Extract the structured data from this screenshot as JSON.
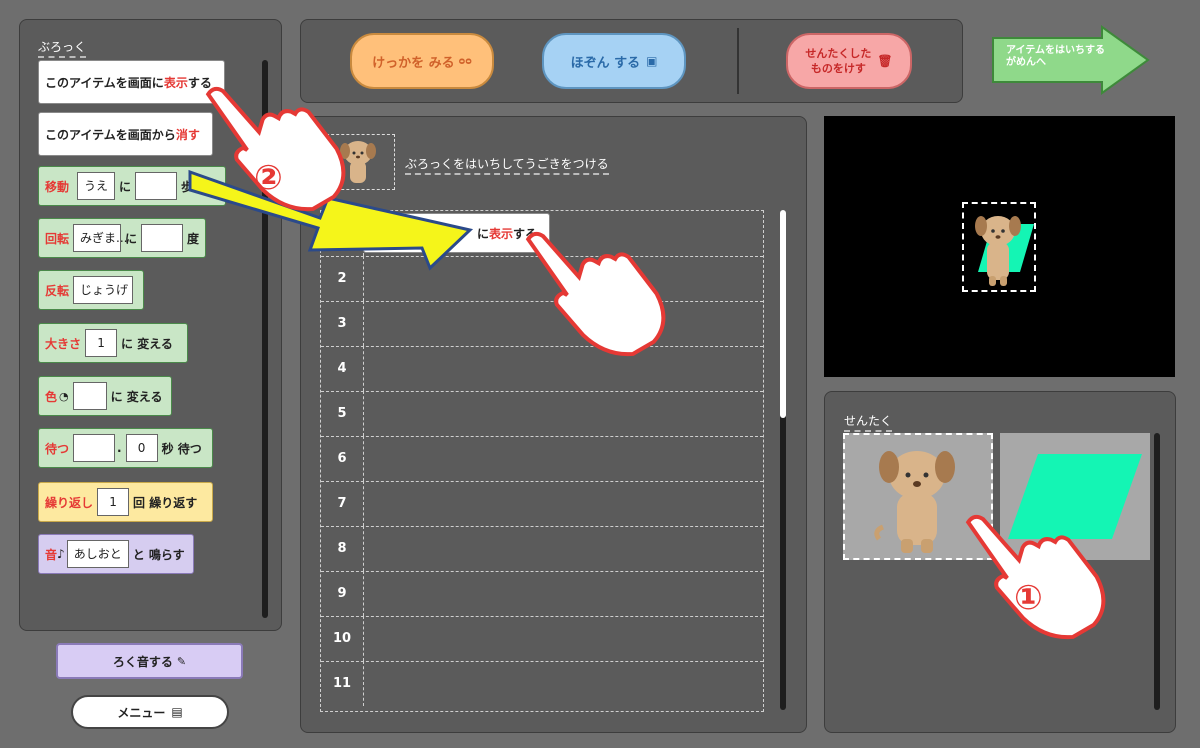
{
  "palette": {
    "title": "ぶろっく",
    "b1": {
      "pre": "このアイテムを画面に",
      "kw": "表示",
      "post": "する"
    },
    "b2": {
      "pre": "このアイテムを画面から",
      "kw": "消す"
    },
    "move": {
      "kw": "移動",
      "dir": "うえ",
      "ni": "に",
      "steps": "歩"
    },
    "rotate": {
      "kw": "回転",
      "dir": "みぎま...",
      "ni": "に",
      "unit": "度"
    },
    "flip": {
      "kw": "反転",
      "dir": "じょうげ"
    },
    "size": {
      "kw": "大きさ",
      "val": "1",
      "post": "に 変える"
    },
    "color": {
      "kw": "色",
      "post": "に 変える"
    },
    "wait": {
      "kw": "待つ",
      "dot": ".",
      "val": "0",
      "post": "秒 待つ"
    },
    "repeat": {
      "kw": "繰り返し",
      "val": "1",
      "post": "回 繰り返す"
    },
    "sound": {
      "kw": "音",
      "note": "♪",
      "val": "あしおと",
      "post": "と 鳴らす"
    }
  },
  "record_button": "ろく音する",
  "menu_button": "メニュー",
  "toolbar": {
    "result": "けっかを みる",
    "save": "ほぞん する",
    "erase_l1": "せんたくした",
    "erase_l2": "ものをけす",
    "next_l1": "アイテムをはいちする",
    "next_l2": "がめんへ"
  },
  "script": {
    "instruction": "ぶろっくをはいちしてうごきをつける",
    "row1_block": {
      "kw": "表示",
      "post": "する",
      "pre_visible": "に"
    },
    "row_numbers": [
      "1",
      "2",
      "3",
      "4",
      "5",
      "6",
      "7",
      "8",
      "9",
      "10",
      "11"
    ]
  },
  "selection": {
    "title": "せんたく"
  },
  "annotations": {
    "step1": "①",
    "step2": "②"
  },
  "colors": {
    "accent_red": "#e53935",
    "item_green": "#14f5b4"
  }
}
